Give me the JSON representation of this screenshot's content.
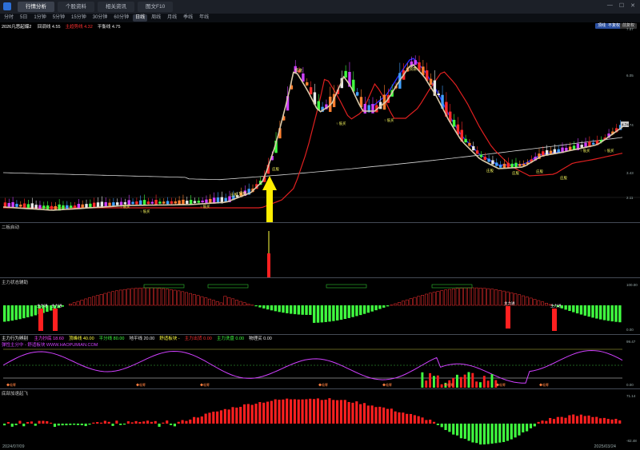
{
  "tabs": [
    "行情分析",
    "个股资料",
    "相关资讯",
    "图文F10"
  ],
  "active_tab": 0,
  "periods": [
    "分时",
    "5日",
    "1分钟",
    "5分钟",
    "15分钟",
    "30分钟",
    "60分钟",
    "日线",
    "周线",
    "月线",
    "季线",
    "年线"
  ],
  "active_period": 7,
  "main_panel": {
    "title": "2026凡思起爆2",
    "legend": [
      {
        "text": "回调线 4.55",
        "color": "#e8e8e8"
      },
      {
        "text": "主趋势线 4.32",
        "color": "#ff3030"
      },
      {
        "text": "平衡线 4.75",
        "color": "#e8e8e8"
      }
    ],
    "buttons": [
      "顶线",
      "不复权",
      "前复权"
    ],
    "axis": [
      "7.07",
      "6.05",
      "4.74",
      "3.43",
      "2.11"
    ],
    "last_price": "4.74",
    "labels": {
      "top": "顶意",
      "dig": "庄股",
      "buy": "低买",
      "hold": "庄股"
    }
  },
  "panel2": {
    "title": "二板启动"
  },
  "panel3": {
    "title": "主力状态辅助",
    "axis": [
      "100.00",
      "0.00"
    ],
    "label": "主力进"
  },
  "panel4": {
    "title": "主力行为辨别",
    "legend": [
      {
        "text": "主力抄底 18.60",
        "color": "#ff40ff"
      },
      {
        "text": "顶峰线 40.00",
        "color": "#ffff40"
      },
      {
        "text": "平分线 80.00",
        "color": "#40ff40"
      },
      {
        "text": "地平线 20.00",
        "color": "#e8e8e8"
      },
      {
        "text": "舒适板块 -",
        "color": "#ffff40"
      },
      {
        "text": "主力出货 0.00",
        "color": "#ff3030"
      },
      {
        "text": "主力洗盘 0.00",
        "color": "#40ff40"
      },
      {
        "text": "物理买 0.00",
        "color": "#e8e8e8"
      }
    ],
    "sub": "弹性主分中 - 舒适板块 WWW.HAOPUMIAN.COM",
    "axis": [
      "99.47",
      "0.00"
    ],
    "mark": "吸筹"
  },
  "panel5": {
    "title": "底部加速起飞",
    "axis": [
      "71.14",
      "-82.48"
    ]
  },
  "dates": {
    "start": "2024/07/09",
    "end": "2025/03/24"
  },
  "colors": {
    "up": "#ff2a2a",
    "down": "#40ff40",
    "blue": "#2b2bff",
    "tan": "#d8c8a8",
    "yellow": "#ffff30",
    "magenta": "#d040ff"
  }
}
